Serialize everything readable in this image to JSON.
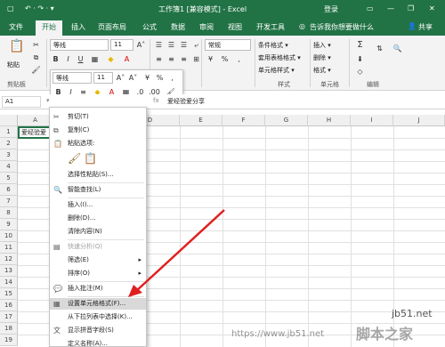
{
  "window": {
    "title": "工作簿1 [兼容模式] - Excel",
    "login": "登录",
    "minimize": "—",
    "restore": "❐",
    "close": "✕",
    "quick_access": "↶ · ↷ · ▾",
    "menu_icon": "▢"
  },
  "tabs": [
    "文件",
    "开始",
    "插入",
    "页面布局",
    "公式",
    "数据",
    "审阅",
    "视图",
    "开发工具"
  ],
  "tell_me": "告诉我你想要做什么",
  "share": "共享",
  "ribbon": {
    "paste": "粘贴",
    "font_name": "等线",
    "font_size": "11",
    "number_format": "常规",
    "styles": [
      "条件格式 ▾",
      "套用表格格式 ▾",
      "单元格样式 ▾"
    ],
    "cells": [
      "插入 ▾",
      "删除 ▾",
      "格式 ▾"
    ],
    "groups": {
      "clipboard": "剪贴板",
      "styles": "样式",
      "cells": "单元格",
      "editing": "编辑"
    }
  },
  "mini_toolbar": {
    "font_name": "等线",
    "font_size": "11"
  },
  "formula_bar": {
    "name_box": "A1",
    "value": "爱经验爱分享"
  },
  "columns": [
    "A",
    "B",
    "C",
    "D",
    "E",
    "F",
    "G",
    "H",
    "I",
    "J"
  ],
  "rows": [
    "1",
    "2",
    "3",
    "4",
    "5",
    "6",
    "7",
    "8",
    "9",
    "10",
    "11",
    "12",
    "13",
    "14",
    "15",
    "16",
    "17",
    "18",
    "19"
  ],
  "cell_a1": "爱经验爱",
  "context_menu": {
    "cut": "剪切(T)",
    "copy": "复制(C)",
    "paste_options": "粘贴选项:",
    "paste_special": "选择性粘贴(S)...",
    "smart_lookup": "智能查找(L)",
    "insert": "插入(I)...",
    "delete": "删除(D)...",
    "clear": "清除内容(N)",
    "quick_analysis": "快速分析(Q)",
    "filter": "筛选(E)",
    "sort": "排序(O)",
    "insert_comment": "插入批注(M)",
    "format_cells": "设置单元格格式(F)...",
    "pick_list": "从下拉列表中选择(K)...",
    "phonetic": "显示拼音字段(S)",
    "define_name": "定义名称(A)..."
  },
  "watermark": {
    "site": "jb51.net",
    "url": "https://www.jb51.net",
    "brand": "脚本之家"
  },
  "colors": {
    "excel_green": "#217346",
    "arrow": "#e02020"
  }
}
